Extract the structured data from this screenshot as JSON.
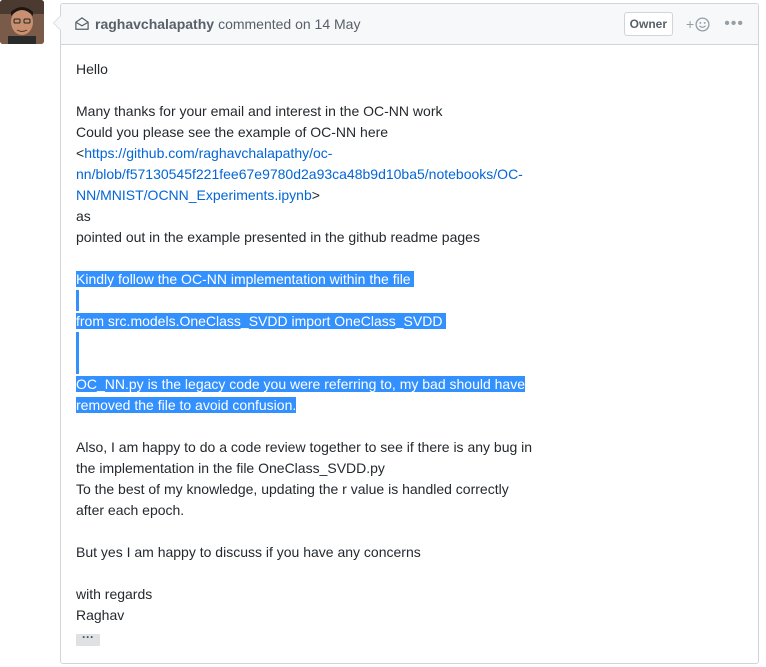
{
  "comment": {
    "author": "raghavchalapathy",
    "action": "commented on 14 May",
    "badge": "Owner",
    "reaction_plus": "+",
    "more_label": "•••",
    "body": {
      "greeting": "Hello",
      "p1_l1": "Many thanks for your email and interest  in the OC-NN work",
      "p1_l2": "Could you please see the example of OC-NN here",
      "link_open": "<",
      "link_l1": "https://github.com/raghavchalapathy/oc-",
      "link_l2": "nn/blob/f57130545f221fee67e9780d2a93ca48b9d10ba5/notebooks/OC-",
      "link_l3": "NN/MNIST/OCNN_Experiments.ipynb",
      "link_close": ">",
      "as": "as",
      "readme": "pointed out in the example presented in the github readme pages",
      "hl1": "Kindly follow the OC-NN implementation within the file",
      "hl2": "from src.models.OneClass_SVDD import OneClass_SVDD",
      "hl3": "OC_NN.py is the legacy code you were referring to, my bad should have",
      "hl4": "removed the file to avoid confusion.",
      "p3_l1": "Also, I am happy to do a code review together to see if there is any bug in",
      "p3_l2": "the implementation in the file OneClass_SVDD.py",
      "p3_l3": "To the best of my knowledge, updating the r value is handled correctly",
      "p3_l4": "after each epoch.",
      "p4": "But yes I am happy to discuss if you have any concerns",
      "sign1": "with regards",
      "sign2": "Raghav",
      "expand": "···"
    }
  },
  "icons": {
    "header": "mail-icon",
    "reaction": "smiley-icon",
    "menu": "kebab-horizontal-icon"
  }
}
